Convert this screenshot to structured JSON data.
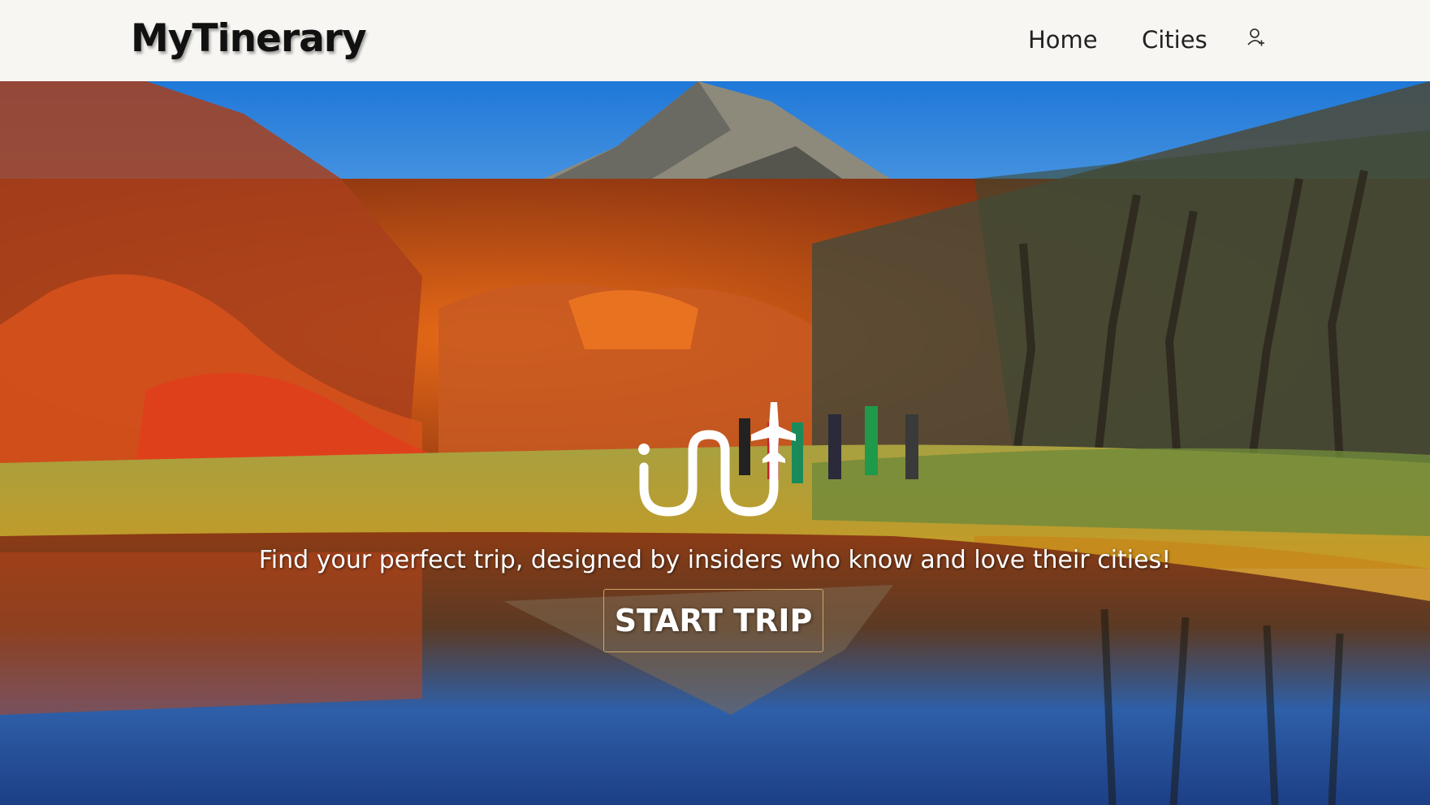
{
  "header": {
    "brand": "MyTinerary",
    "nav": [
      {
        "label": "Home"
      },
      {
        "label": "Cities"
      }
    ],
    "user_icon": "user-add-icon"
  },
  "hero": {
    "background": "autumn-mountain-lake-photo",
    "logo_icon": "route-plane-logo-icon",
    "tagline": "Find your perfect trip, designed by insiders who know and love their cities!",
    "cta_label": "START TRIP"
  },
  "colors": {
    "header_bg": "#f8f6f2",
    "text_dark": "#111111",
    "cta_border": "#e6be6e"
  }
}
